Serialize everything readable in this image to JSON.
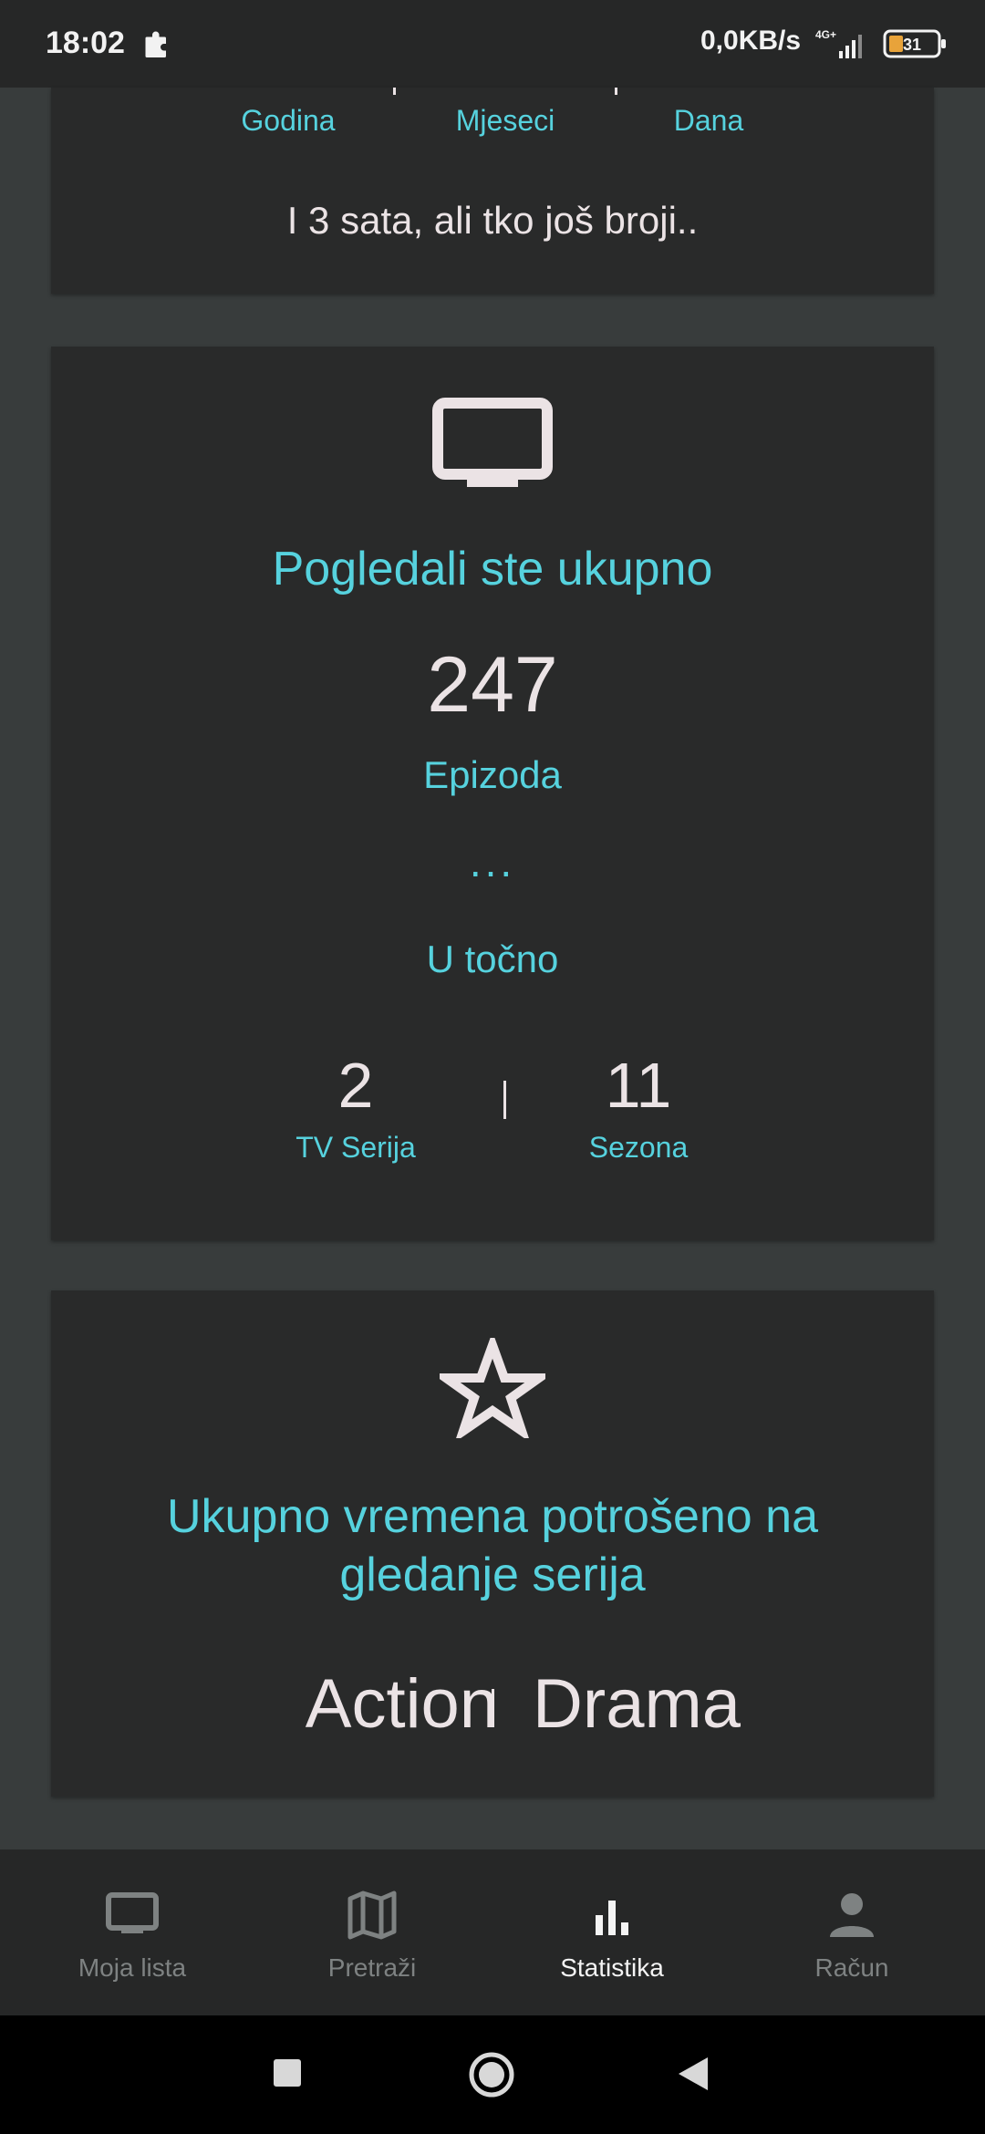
{
  "status_bar": {
    "time": "18:02",
    "network_speed": "0,0KB/s",
    "network_type": "4G+",
    "battery": "31"
  },
  "card_years": {
    "labels": [
      "Godina",
      "Mjeseci",
      "Dana"
    ],
    "subtitle": "I 3 sata, ali tko još broji.."
  },
  "card_total": {
    "icon": "tv-icon",
    "title": "Pogledali ste ukupno",
    "episodes_value": "247",
    "episodes_label": "Epizoda",
    "ellipsis": "...",
    "exact_label": "U točno",
    "series_value": "2",
    "series_label": "TV Serija",
    "seasons_value": "11",
    "seasons_label": "Sezona"
  },
  "card_genre": {
    "icon": "star-outline-icon",
    "title_line1": "Ukupno vremena potrošeno na",
    "title_line2": "gledanje serija",
    "genre1": "Action",
    "genre2": "Drama"
  },
  "bottom_nav": {
    "items": [
      {
        "label": "Moja lista",
        "icon": "tv-icon",
        "active": false
      },
      {
        "label": "Pretraži",
        "icon": "map-icon",
        "active": false
      },
      {
        "label": "Statistika",
        "icon": "bar-chart-icon",
        "active": true
      },
      {
        "label": "Račun",
        "icon": "person-icon",
        "active": false
      }
    ]
  },
  "colors": {
    "accent": "#56d2de",
    "card": "#292a2a",
    "background": "#383c3c",
    "text": "#ebe3e5"
  }
}
